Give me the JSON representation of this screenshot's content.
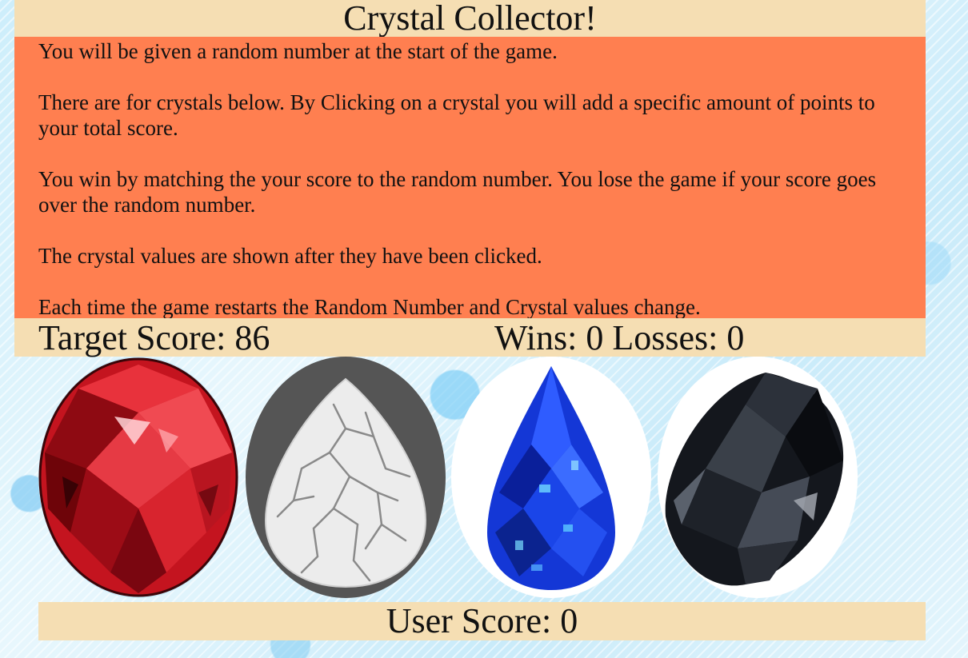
{
  "title": "Crystal Collector!",
  "instructions": [
    "You will be given a random number at the start of the game.",
    "There are for crystals below. By Clicking on a crystal you will add a specific amount of points to your total score.",
    "You win by matching the your score to the random number. You lose the game if your score goes over the random number.",
    "The crystal values are shown after they have been clicked.",
    "Each time the game restarts the Random Number and Crystal values change."
  ],
  "target_score_text": "Target Score: 86",
  "record_text": "Wins: 0 Losses: 0",
  "user_score_text": "User Score: 0",
  "colors": {
    "panel": "#f5deb3",
    "instructions_bg": "#ff7f50"
  },
  "crystals": [
    {
      "name": "red-ruby-crystal",
      "color": "#d21f2a"
    },
    {
      "name": "white-howlite-crystal",
      "color": "#e8e8e8"
    },
    {
      "name": "blue-sapphire-crystal",
      "color": "#1537d8"
    },
    {
      "name": "black-onyx-crystal",
      "color": "#1a1d24"
    }
  ]
}
